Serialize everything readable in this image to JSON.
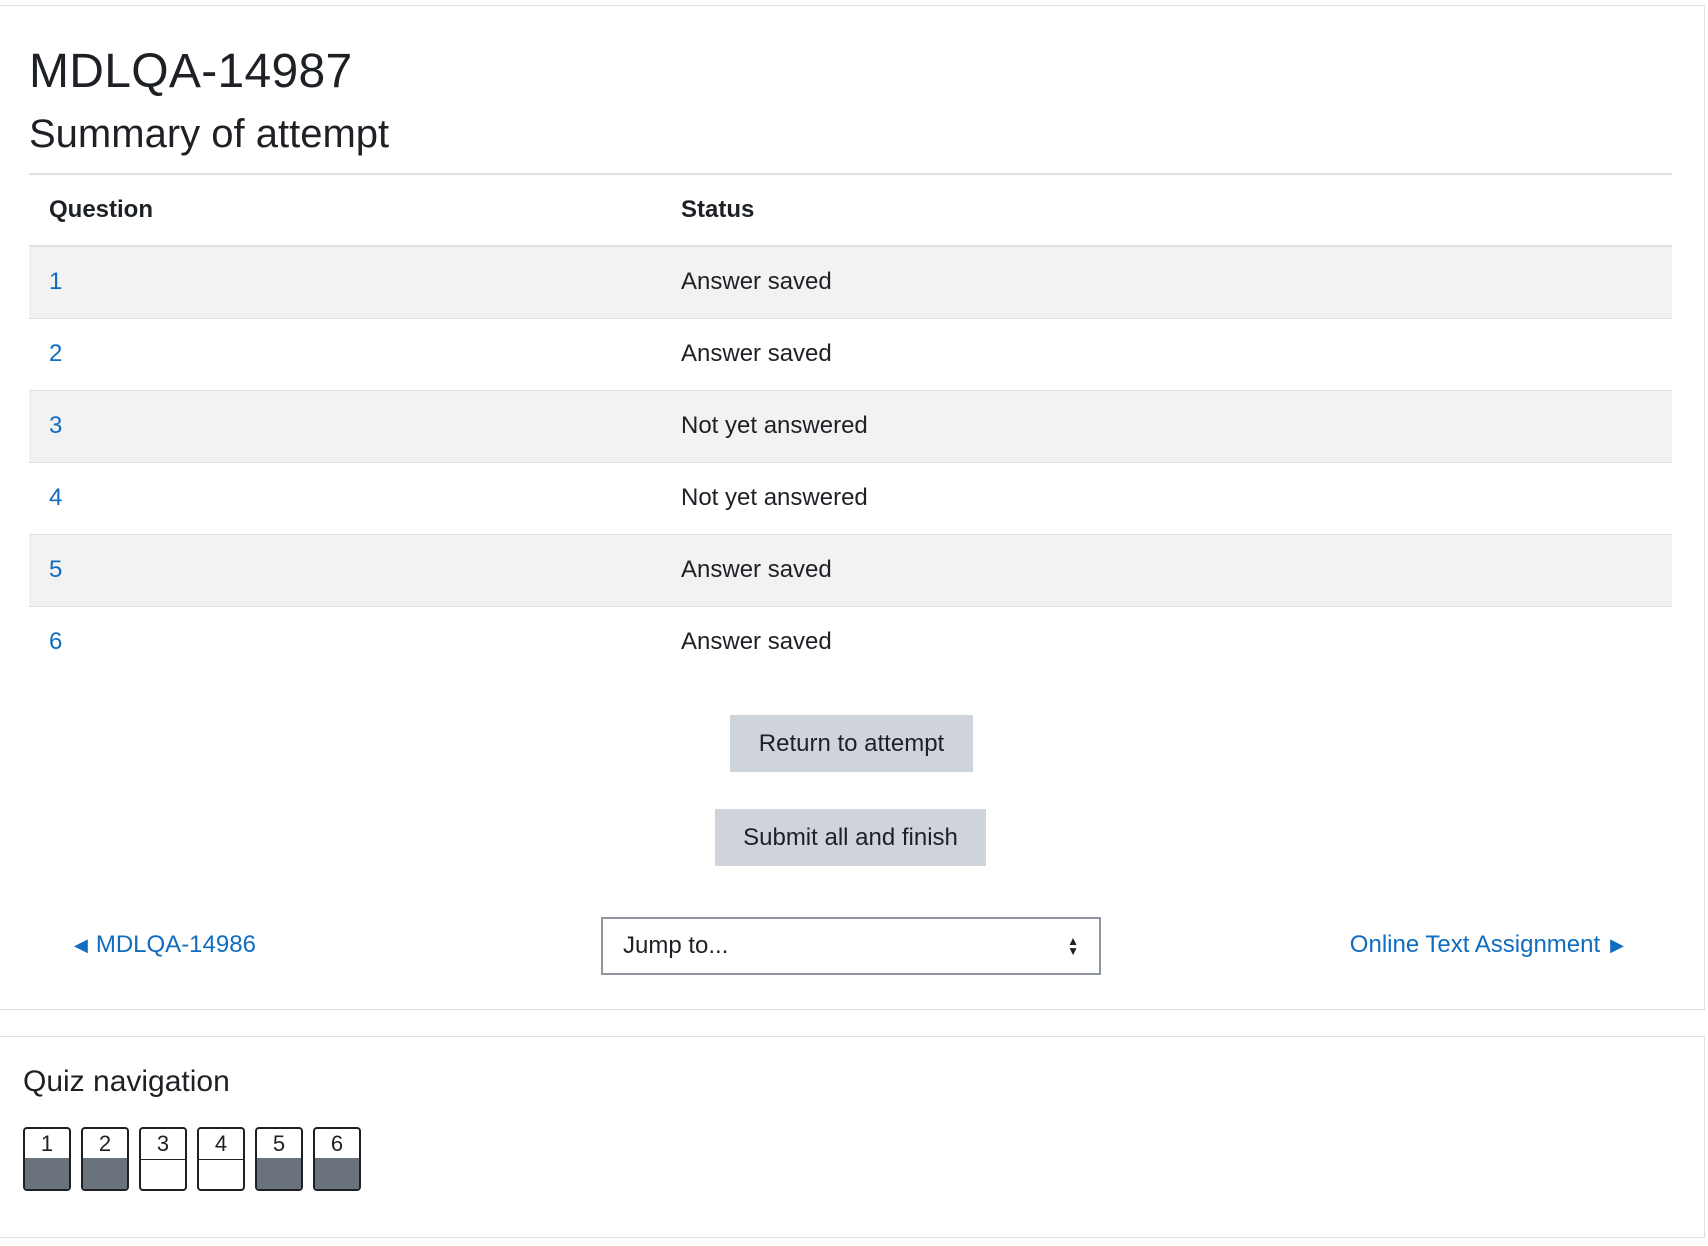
{
  "page": {
    "title": "MDLQA-14987",
    "section_title": "Summary of attempt"
  },
  "table": {
    "headers": [
      "Question",
      "Status"
    ],
    "rows": [
      {
        "question": "1",
        "status": "Answer saved"
      },
      {
        "question": "2",
        "status": "Answer saved"
      },
      {
        "question": "3",
        "status": "Not yet answered"
      },
      {
        "question": "4",
        "status": "Not yet answered"
      },
      {
        "question": "5",
        "status": "Answer saved"
      },
      {
        "question": "6",
        "status": "Answer saved"
      }
    ]
  },
  "buttons": {
    "return_label": "Return to attempt",
    "submit_label": "Submit all and finish"
  },
  "activity_nav": {
    "prev_label": "MDLQA-14986",
    "prev_icon": "triangle-left-icon",
    "next_label": "Online Text Assignment",
    "next_icon": "triangle-right-icon",
    "jump_label": "Jump to..."
  },
  "quiz_navigation": {
    "title": "Quiz navigation",
    "items": [
      {
        "label": "1",
        "answered": true
      },
      {
        "label": "2",
        "answered": true
      },
      {
        "label": "3",
        "answered": false
      },
      {
        "label": "4",
        "answered": false
      },
      {
        "label": "5",
        "answered": true
      },
      {
        "label": "6",
        "answered": true
      }
    ]
  },
  "colors": {
    "link": "#0f6cbf",
    "button_bg": "#ced4da",
    "answered_fill": "#6a737b",
    "row_stripe": "#f2f2f2"
  }
}
